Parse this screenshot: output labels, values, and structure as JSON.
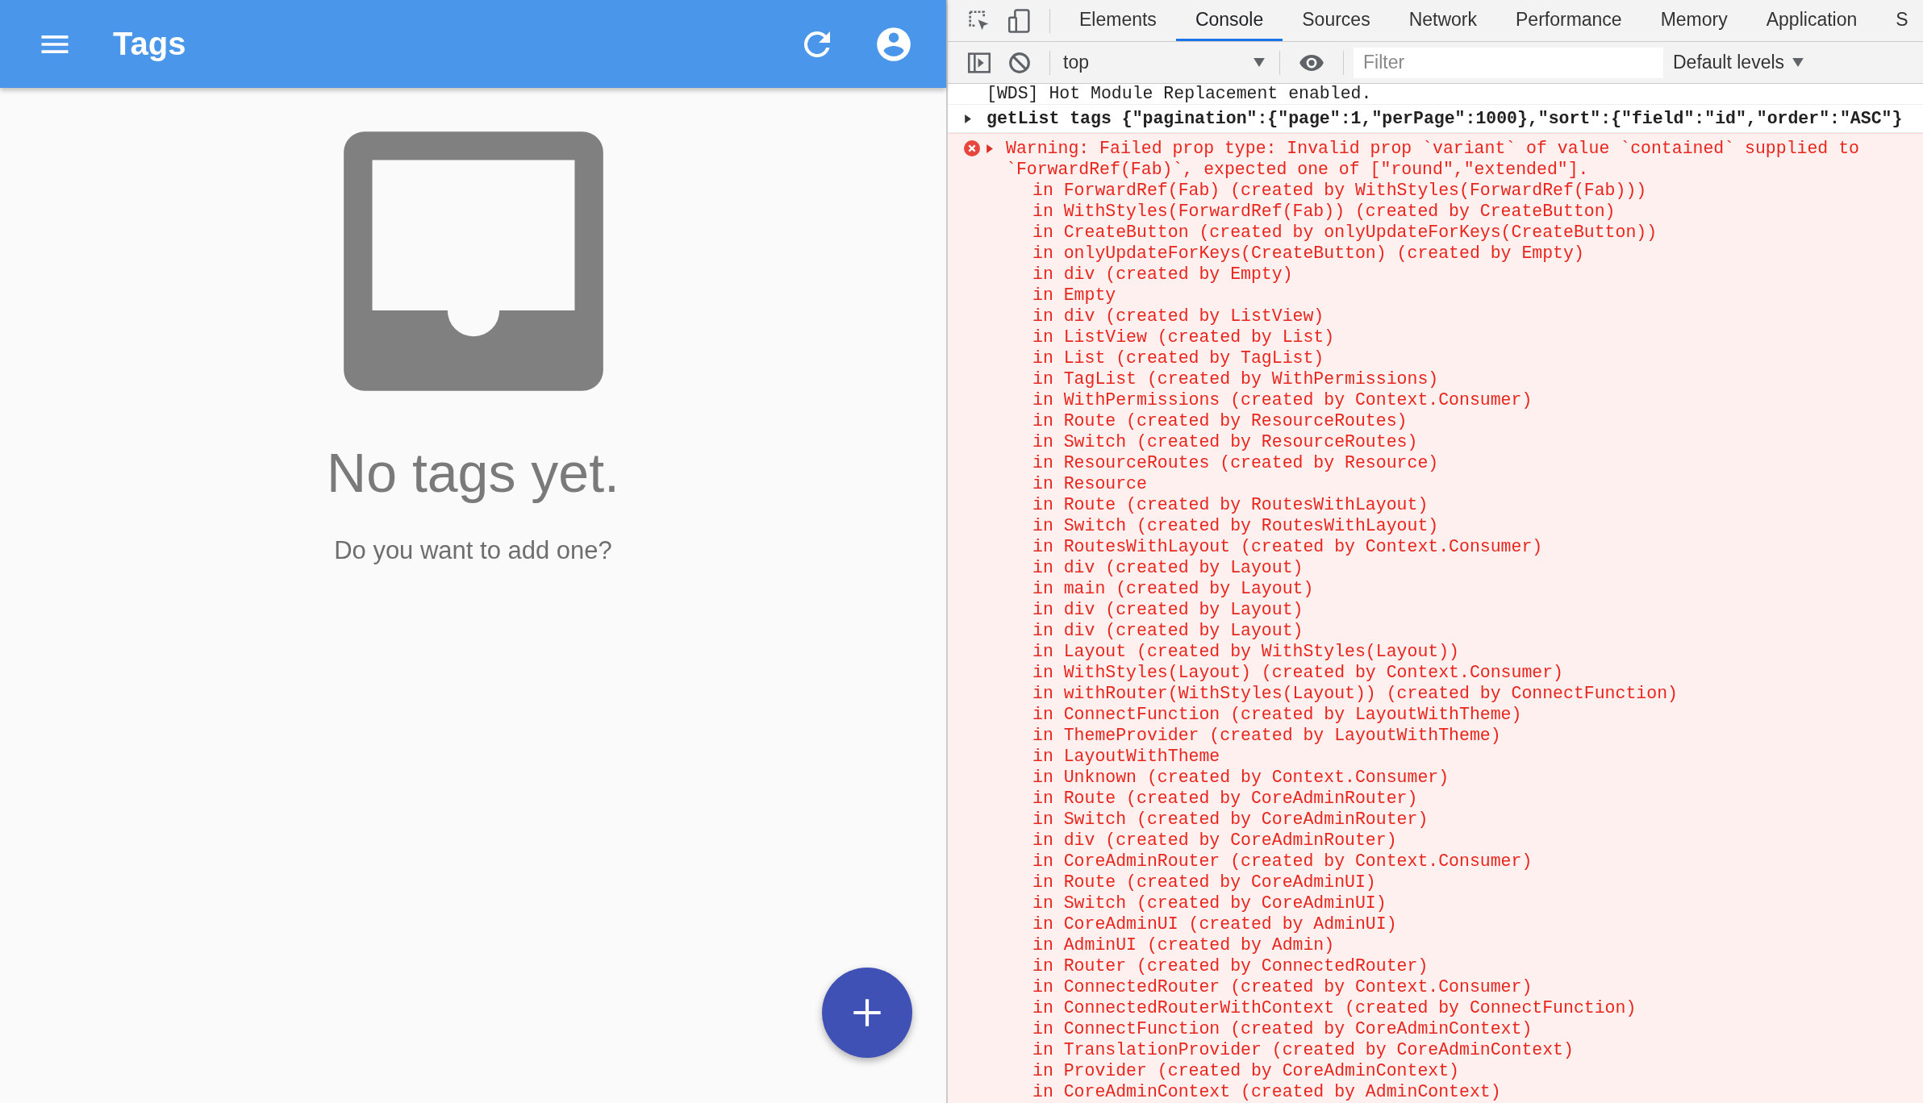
{
  "app_bar": {
    "title": "Tags"
  },
  "empty_state": {
    "heading": "No tags yet.",
    "message": "Do you want to add one?"
  },
  "devtools": {
    "tabs": [
      {
        "label": "Elements",
        "selected": false
      },
      {
        "label": "Console",
        "selected": true
      },
      {
        "label": "Sources",
        "selected": false
      },
      {
        "label": "Network",
        "selected": false
      },
      {
        "label": "Performance",
        "selected": false
      },
      {
        "label": "Memory",
        "selected": false
      },
      {
        "label": "Application",
        "selected": false
      },
      {
        "label": "S",
        "selected": false
      }
    ],
    "toolbar": {
      "context": "top",
      "filter_placeholder": "Filter",
      "levels": "Default levels"
    },
    "messages": [
      {
        "kind": "log",
        "text": "[WDS] Hot Module Replacement enabled."
      },
      {
        "kind": "group",
        "expanded": false,
        "text": "getList tags {\"pagination\":{\"page\":1,\"perPage\":1000},\"sort\":{\"field\":\"id\",\"order\":\"ASC\"}"
      },
      {
        "kind": "error",
        "expanded": false,
        "text": "Warning: Failed prop type: Invalid prop `variant` of value `contained` supplied to `ForwardRef(Fab)`, expected one of [\"round\",\"extended\"].",
        "stack": [
          "in ForwardRef(Fab) (created by WithStyles(ForwardRef(Fab)))",
          "in WithStyles(ForwardRef(Fab)) (created by CreateButton)",
          "in CreateButton (created by onlyUpdateForKeys(CreateButton))",
          "in onlyUpdateForKeys(CreateButton) (created by Empty)",
          "in div (created by Empty)",
          "in Empty",
          "in div (created by ListView)",
          "in ListView (created by List)",
          "in List (created by TagList)",
          "in TagList (created by WithPermissions)",
          "in WithPermissions (created by Context.Consumer)",
          "in Route (created by ResourceRoutes)",
          "in Switch (created by ResourceRoutes)",
          "in ResourceRoutes (created by Resource)",
          "in Resource",
          "in Route (created by RoutesWithLayout)",
          "in Switch (created by RoutesWithLayout)",
          "in RoutesWithLayout (created by Context.Consumer)",
          "in div (created by Layout)",
          "in main (created by Layout)",
          "in div (created by Layout)",
          "in div (created by Layout)",
          "in Layout (created by WithStyles(Layout))",
          "in WithStyles(Layout) (created by Context.Consumer)",
          "in withRouter(WithStyles(Layout)) (created by ConnectFunction)",
          "in ConnectFunction (created by LayoutWithTheme)",
          "in ThemeProvider (created by LayoutWithTheme)",
          "in LayoutWithTheme",
          "in Unknown (created by Context.Consumer)",
          "in Route (created by CoreAdminRouter)",
          "in Switch (created by CoreAdminRouter)",
          "in div (created by CoreAdminRouter)",
          "in CoreAdminRouter (created by Context.Consumer)",
          "in Route (created by CoreAdminUI)",
          "in Switch (created by CoreAdminUI)",
          "in CoreAdminUI (created by AdminUI)",
          "in AdminUI (created by Admin)",
          "in Router (created by ConnectedRouter)",
          "in ConnectedRouter (created by Context.Consumer)",
          "in ConnectedRouterWithContext (created by ConnectFunction)",
          "in ConnectFunction (created by CoreAdminContext)",
          "in TranslationProvider (created by CoreAdminContext)",
          "in Provider (created by CoreAdminContext)",
          "in CoreAdminContext (created by AdminContext)"
        ]
      }
    ]
  }
}
